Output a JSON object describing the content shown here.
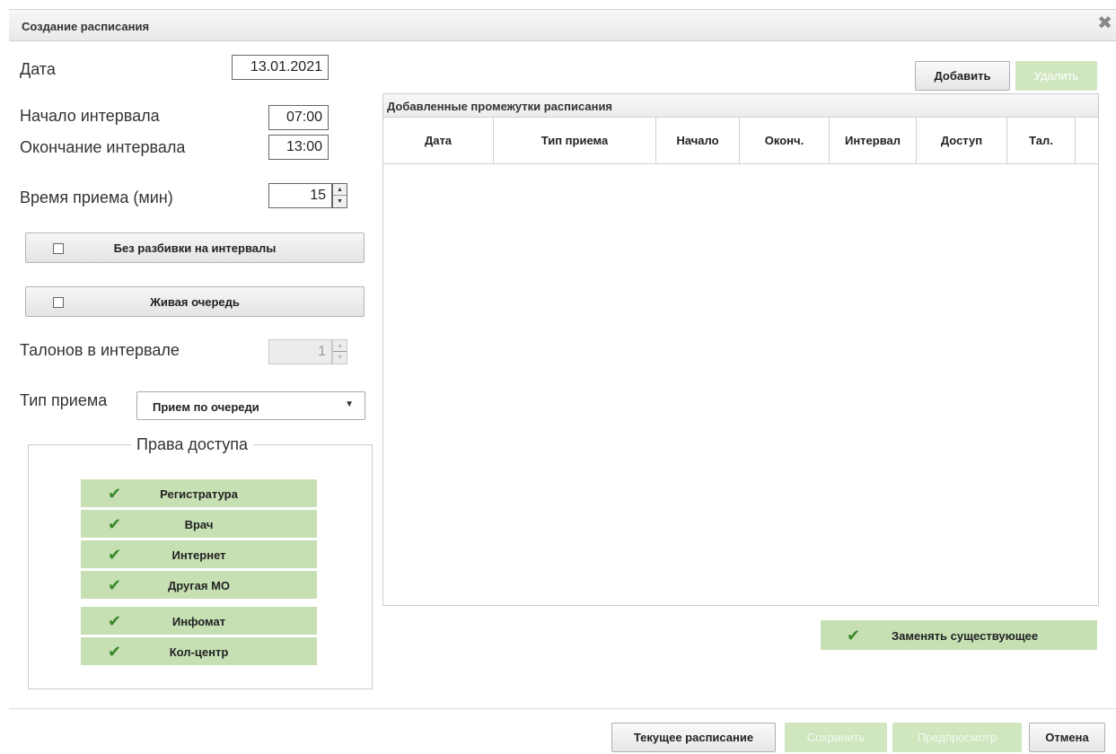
{
  "window": {
    "title": "Создание расписания"
  },
  "form": {
    "date_label": "Дата",
    "date_value": "13.01.2021",
    "start_label": "Начало интервала",
    "start_value": "07:00",
    "end_label": "Окончание интервала",
    "end_value": "13:00",
    "duration_label": "Время приема (мин)",
    "duration_value": "15",
    "no_intervals_label": "Без разбивки на интервалы",
    "live_queue_label": "Живая очередь",
    "tickets_label": "Талонов в интервале",
    "tickets_value": "1",
    "type_label": "Тип приема",
    "type_value": "Прием по очереди"
  },
  "access": {
    "legend": "Права доступа",
    "items": [
      {
        "label": "Регистратура",
        "checked": true
      },
      {
        "label": "Врач",
        "checked": true
      },
      {
        "label": "Интернет",
        "checked": true
      },
      {
        "label": "Другая МО",
        "checked": true
      },
      {
        "label": "Инфомат",
        "checked": true
      },
      {
        "label": "Кол-центр",
        "checked": true
      }
    ]
  },
  "grid": {
    "add_label": "Добавить",
    "delete_label": "Удалить",
    "title": "Добавленные промежутки расписания",
    "columns": [
      "Дата",
      "Тип приема",
      "Начало",
      "Оконч.",
      "Интервал",
      "Доступ",
      "Тал."
    ],
    "rows": []
  },
  "replace_existing": {
    "label": "Заменять существующее",
    "checked": true
  },
  "footer": {
    "current_label": "Текущее расписание",
    "save_label": "Сохранить",
    "preview_label": "Предпросмотр",
    "cancel_label": "Отмена"
  },
  "colors": {
    "accent_green": "#c6e0b4",
    "disabled_green": "#cfe6bf",
    "check_green": "#3a8a2a"
  },
  "icons": {
    "close": "close-icon",
    "check": "checkmark-icon",
    "dropdown": "chevron-down-icon"
  }
}
